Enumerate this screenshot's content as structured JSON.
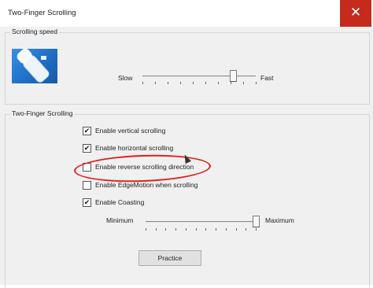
{
  "window": {
    "title": "Two-Finger Scrolling",
    "close_glyph": "✕"
  },
  "scrolling_speed": {
    "group_label": "Scrolling speed",
    "icon": "two-finger-scroll-icon",
    "min_label": "Slow",
    "max_label": "Fast",
    "value_fraction": 0.8
  },
  "two_finger_scrolling": {
    "group_label": "Two-Finger Scrolling",
    "options": [
      {
        "label": "Enable vertical scrolling",
        "checked": true
      },
      {
        "label": "Enable horizontal scrolling",
        "checked": true
      },
      {
        "label": "Enable reverse scrolling direction",
        "checked": false
      },
      {
        "label": "Enable EdgeMotion when scrolling",
        "checked": false
      },
      {
        "label": "Enable Coasting",
        "checked": true
      }
    ],
    "coasting": {
      "min_label": "Minimum",
      "max_label": "Maximum",
      "value_fraction": 1.0
    },
    "practice_label": "Practice"
  },
  "colors": {
    "annotation": "#e0201a",
    "close_button": "#c42b1c",
    "icon_blue": "#1f6fc4"
  }
}
